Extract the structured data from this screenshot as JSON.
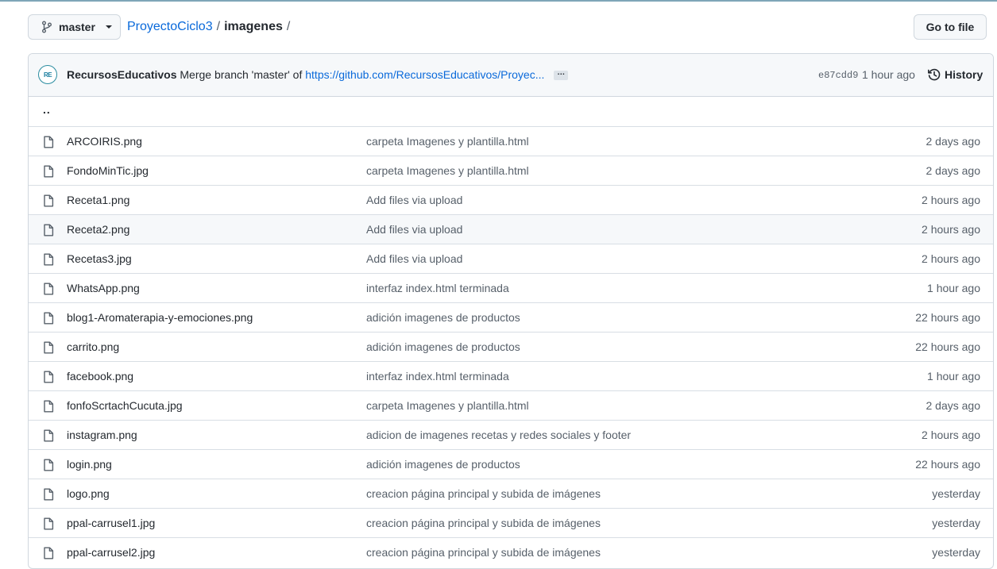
{
  "header": {
    "branch": "master",
    "repo": "ProyectoCiclo3",
    "separator": "/",
    "directory": "imagenes",
    "go_to_file": "Go to file"
  },
  "commit": {
    "avatar_text": "RE",
    "author": "RecursosEducativos",
    "message": "Merge branch 'master' of",
    "link": "https://github.com/RecursosEducativos/Proyec...",
    "ellipsis": "…",
    "sha": "e87cdd9",
    "time": "1 hour ago",
    "history_label": "History"
  },
  "parent_link": "..",
  "files": [
    {
      "name": "ARCOIRIS.png",
      "message": "carpeta Imagenes y plantilla.html",
      "age": "2 days ago"
    },
    {
      "name": "FondoMinTic.jpg",
      "message": "carpeta Imagenes y plantilla.html",
      "age": "2 days ago"
    },
    {
      "name": "Receta1.png",
      "message": "Add files via upload",
      "age": "2 hours ago"
    },
    {
      "name": "Receta2.png",
      "message": "Add files via upload",
      "age": "2 hours ago"
    },
    {
      "name": "Recetas3.jpg",
      "message": "Add files via upload",
      "age": "2 hours ago"
    },
    {
      "name": "WhatsApp.png",
      "message": "interfaz index.html terminada",
      "age": "1 hour ago"
    },
    {
      "name": "blog1-Aromaterapia-y-emociones.png",
      "message": "adición imagenes de productos",
      "age": "22 hours ago"
    },
    {
      "name": "carrito.png",
      "message": "adición imagenes de productos",
      "age": "22 hours ago"
    },
    {
      "name": "facebook.png",
      "message": "interfaz index.html terminada",
      "age": "1 hour ago"
    },
    {
      "name": "fonfoScrtachCucuta.jpg",
      "message": "carpeta Imagenes y plantilla.html",
      "age": "2 days ago"
    },
    {
      "name": "instagram.png",
      "message": "adicion de imagenes recetas y redes sociales y footer",
      "age": "2 hours ago"
    },
    {
      "name": "login.png",
      "message": "adición imagenes de productos",
      "age": "22 hours ago"
    },
    {
      "name": "logo.png",
      "message": "creacion página principal y subida de imágenes",
      "age": "yesterday"
    },
    {
      "name": "ppal-carrusel1.jpg",
      "message": "creacion página principal y subida de imágenes",
      "age": "yesterday"
    },
    {
      "name": "ppal-carrusel2.jpg",
      "message": "creacion página principal y subida de imágenes",
      "age": "yesterday"
    }
  ],
  "hovered_row_index": 3,
  "icons": {
    "branch": "git-branch-icon",
    "history": "history-clock-icon",
    "file": "file-icon"
  }
}
